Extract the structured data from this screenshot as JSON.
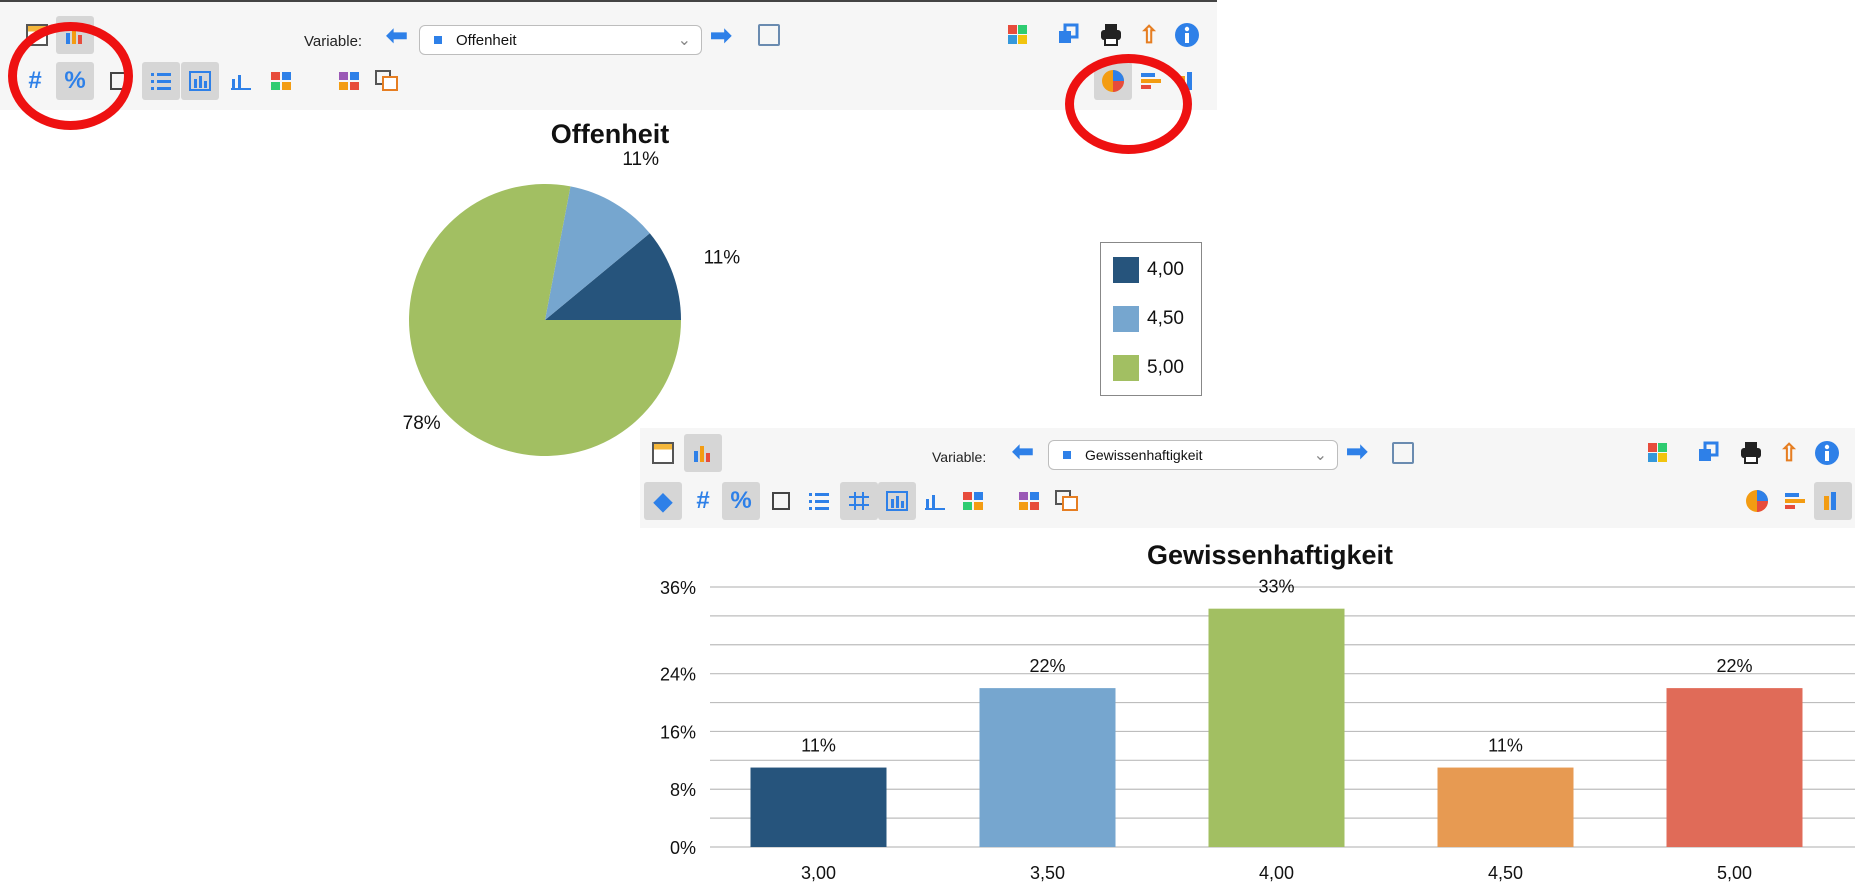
{
  "top_window": {
    "variable_label": "Variable:",
    "variable_value": "Offenheit",
    "toolbar_row2": {
      "hash": "#",
      "percent": "%"
    }
  },
  "bottom_window": {
    "variable_label": "Variable:",
    "variable_value": "Gewissenhaftigkeit",
    "toolbar_row2": {
      "hash": "#",
      "percent": "%"
    }
  },
  "colors": {
    "dark_blue": "#26547c",
    "light_blue": "#76a6cf",
    "green": "#a2bf62",
    "orange": "#e79a52",
    "red": "#e06b58",
    "annotation_red": "#ee1111"
  },
  "chart_data": [
    {
      "type": "pie",
      "title": "Offenheit",
      "slices": [
        {
          "label": "4,00",
          "value": 11,
          "value_label": "11%",
          "color": "#26547c"
        },
        {
          "label": "4,50",
          "value": 11,
          "value_label": "11%",
          "color": "#76a6cf"
        },
        {
          "label": "5,00",
          "value": 78,
          "value_label": "78%",
          "color": "#a2bf62"
        }
      ],
      "legend": [
        "4,00",
        "4,50",
        "5,00"
      ],
      "legend_position": "right"
    },
    {
      "type": "bar",
      "title": "Gewissenhaftigkeit",
      "categories": [
        "3,00",
        "3,50",
        "4,00",
        "4,50",
        "5,00"
      ],
      "values": [
        11,
        22,
        33,
        11,
        22
      ],
      "value_labels": [
        "11%",
        "22%",
        "33%",
        "11%",
        "22%"
      ],
      "colors": [
        "#26547c",
        "#76a6cf",
        "#a2bf62",
        "#e79a52",
        "#e06b58"
      ],
      "ylim": [
        0,
        36
      ],
      "y_ticks": [
        0,
        8,
        16,
        24,
        36
      ],
      "y_tick_labels": [
        "0%",
        "8%",
        "16%",
        "24%",
        "36%"
      ],
      "grid": true
    }
  ]
}
